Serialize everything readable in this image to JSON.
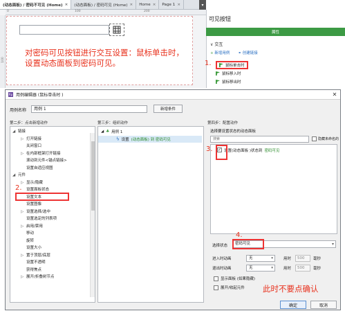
{
  "tabs": [
    {
      "label": "(动态面板) / 密码不可见 (Home)",
      "active": true
    },
    {
      "label": "(动态面板) / 密码可见 (Home)",
      "active": false
    },
    {
      "label": "Home",
      "active": false
    },
    {
      "label": "Page 1",
      "active": false
    }
  ],
  "canvas": {
    "ruler_top": [
      "0",
      "100",
      "200"
    ],
    "ruler_left": [
      "100"
    ],
    "annotation": "对密码可见按钮进行交互设置：鼠标单击时，设置动态面板到密码可见。"
  },
  "right_panel": {
    "title": "可见按钮",
    "tab": "属性",
    "section": "交互",
    "new_case": "新增用例",
    "create_link": "创建链接",
    "events": [
      "鼠标单击时",
      "鼠标移入时",
      "鼠标移出时"
    ],
    "marker": "1."
  },
  "dialog": {
    "title": "用例编辑器 (鼠标单击时 )",
    "case_label": "用例名称",
    "case_name": "用例 1",
    "add_condition": "新增条件",
    "col1": "第二步：点击新增动作",
    "col2": "第三步：组织动作",
    "col3": "第四步：配置动作",
    "tree": [
      {
        "label": "链接",
        "level": 0,
        "arrow": "◢"
      },
      {
        "label": "打开链接",
        "level": 1,
        "arrow": "▷"
      },
      {
        "label": "关闭窗口",
        "level": 1,
        "arrow": ""
      },
      {
        "label": "在内部框架打开链接",
        "level": 1,
        "arrow": "▷"
      },
      {
        "label": "滚动到元件<锚点链接>",
        "level": 1,
        "arrow": ""
      },
      {
        "label": "设置自适应视图",
        "level": 1,
        "arrow": ""
      },
      {
        "label": "元件",
        "level": 0,
        "arrow": "◢"
      },
      {
        "label": "显示/隐藏",
        "level": 1,
        "arrow": "▷"
      },
      {
        "label": "设置面板状态",
        "level": 1,
        "arrow": ""
      },
      {
        "label": "设置文本",
        "level": 1,
        "arrow": ""
      },
      {
        "label": "设置图像",
        "level": 1,
        "arrow": ""
      },
      {
        "label": "设置选择/选中",
        "level": 1,
        "arrow": "▷"
      },
      {
        "label": "设置选定的列表项",
        "level": 1,
        "arrow": ""
      },
      {
        "label": "启用/禁用",
        "level": 1,
        "arrow": "▷"
      },
      {
        "label": "移动",
        "level": 1,
        "arrow": ""
      },
      {
        "label": "旋转",
        "level": 1,
        "arrow": ""
      },
      {
        "label": "设置大小",
        "level": 1,
        "arrow": ""
      },
      {
        "label": "置于顶层/底层",
        "level": 1,
        "arrow": "▷"
      },
      {
        "label": "设置不透明",
        "level": 1,
        "arrow": ""
      },
      {
        "label": "获得焦点",
        "level": 1,
        "arrow": ""
      },
      {
        "label": "展开/折叠树节点",
        "level": 1,
        "arrow": "▷"
      }
    ],
    "marker2": "2.",
    "case1": "用例 1",
    "action_prefix": "设置",
    "action_target": "(动态面板) 到 密码可见",
    "p3_label": "选择要设置状态的动态面板",
    "p3_filter_placeholder": "搜索",
    "hide_unnamed": "隐藏未命名的",
    "panel_row_prefix": "设置(动态面板 )状态到",
    "panel_row_state": "密码可见",
    "marker3": "3.",
    "marker4": "4.",
    "state_label": "选择状态",
    "state_value": "密码可见",
    "enter_anim_label": "进入时动画",
    "exit_anim_label": "退出时动画",
    "anim_value": "无",
    "time_label": "用时",
    "time_value": "500",
    "ms_label": "毫秒",
    "opt_show": "显示面板 (如果隐藏)",
    "opt_push": "展开/收起元件",
    "annotation2": "此时不要点确认",
    "ok": "确定",
    "cancel": "取消"
  },
  "colors": {
    "accent_green": "#3c9a44",
    "annotation_red": "#e8321e",
    "link_blue": "#2a6fc2"
  }
}
